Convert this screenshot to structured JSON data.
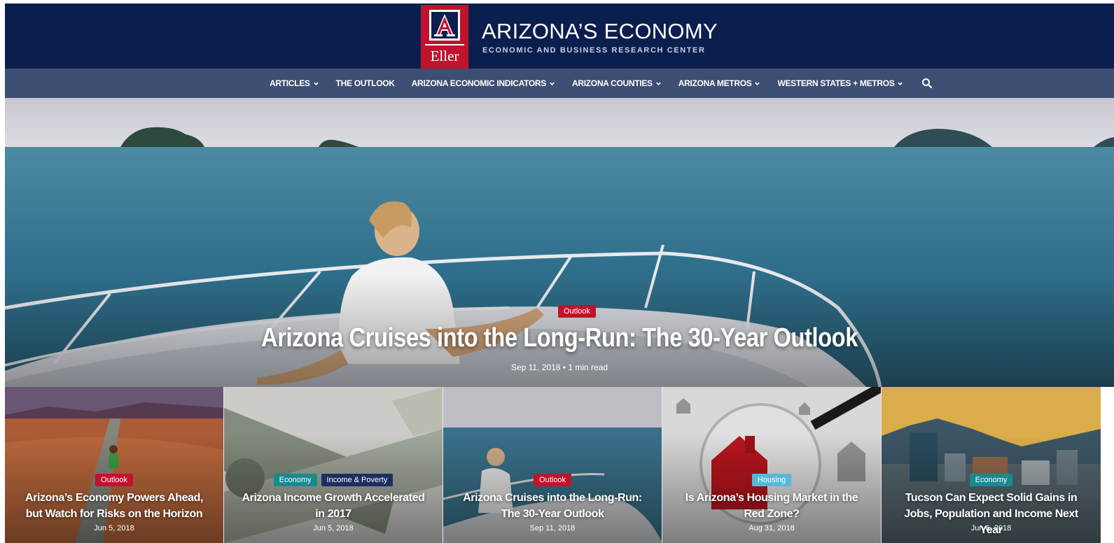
{
  "site": {
    "title": "ARIZONA’S ECONOMY",
    "subtitle": "ECONOMIC AND BUSINESS RESEARCH CENTER",
    "logo_text": "Eller"
  },
  "nav": {
    "items": [
      {
        "label": "ARTICLES",
        "dropdown": true
      },
      {
        "label": "THE OUTLOOK",
        "dropdown": false
      },
      {
        "label": "ARIZONA ECONOMIC INDICATORS",
        "dropdown": true
      },
      {
        "label": "ARIZONA COUNTIES",
        "dropdown": true
      },
      {
        "label": "ARIZONA METROS",
        "dropdown": true
      },
      {
        "label": "WESTERN STATES + METROS",
        "dropdown": true
      }
    ],
    "search_icon": "search-icon"
  },
  "hero": {
    "category": "Outlook",
    "title": "Arizona Cruises into the Long-Run: The 30-Year Outlook",
    "meta": "Sep 11, 2018 • 1 min read"
  },
  "cards": [
    {
      "badges": [
        {
          "label": "Outlook",
          "color": "red"
        }
      ],
      "title": "Arizona’s Economy Powers Ahead, but Watch for Risks on the Horizon",
      "date": "Jun 5, 2018"
    },
    {
      "badges": [
        {
          "label": "Economy",
          "color": "teal"
        },
        {
          "label": "Income & Poverty",
          "color": "navy"
        }
      ],
      "title": "Arizona Income Growth Accelerated in 2017",
      "date": "Jun 5, 2018"
    },
    {
      "badges": [
        {
          "label": "Outlook",
          "color": "red"
        }
      ],
      "title": "Arizona Cruises into the Long-Run: The 30-Year Outlook",
      "date": "Sep 11, 2018"
    },
    {
      "badges": [
        {
          "label": "Housing",
          "color": "sky"
        }
      ],
      "title": "Is Arizona’s Housing Market in the Red Zone?",
      "date": "Aug 31, 2018"
    },
    {
      "badges": [
        {
          "label": "Economy",
          "color": "teal"
        }
      ],
      "title": "Tucson Can Expect Solid Gains in Jobs, Population and Income Next Year",
      "date": "Jun 6, 2018"
    }
  ],
  "colors": {
    "header_bg": "#0b1f4f",
    "nav_bg": "#3d4f73",
    "brand_red": "#c0132e",
    "teal": "#1a8a8f",
    "navy": "#1d2f62",
    "sky": "#59b8d8"
  }
}
